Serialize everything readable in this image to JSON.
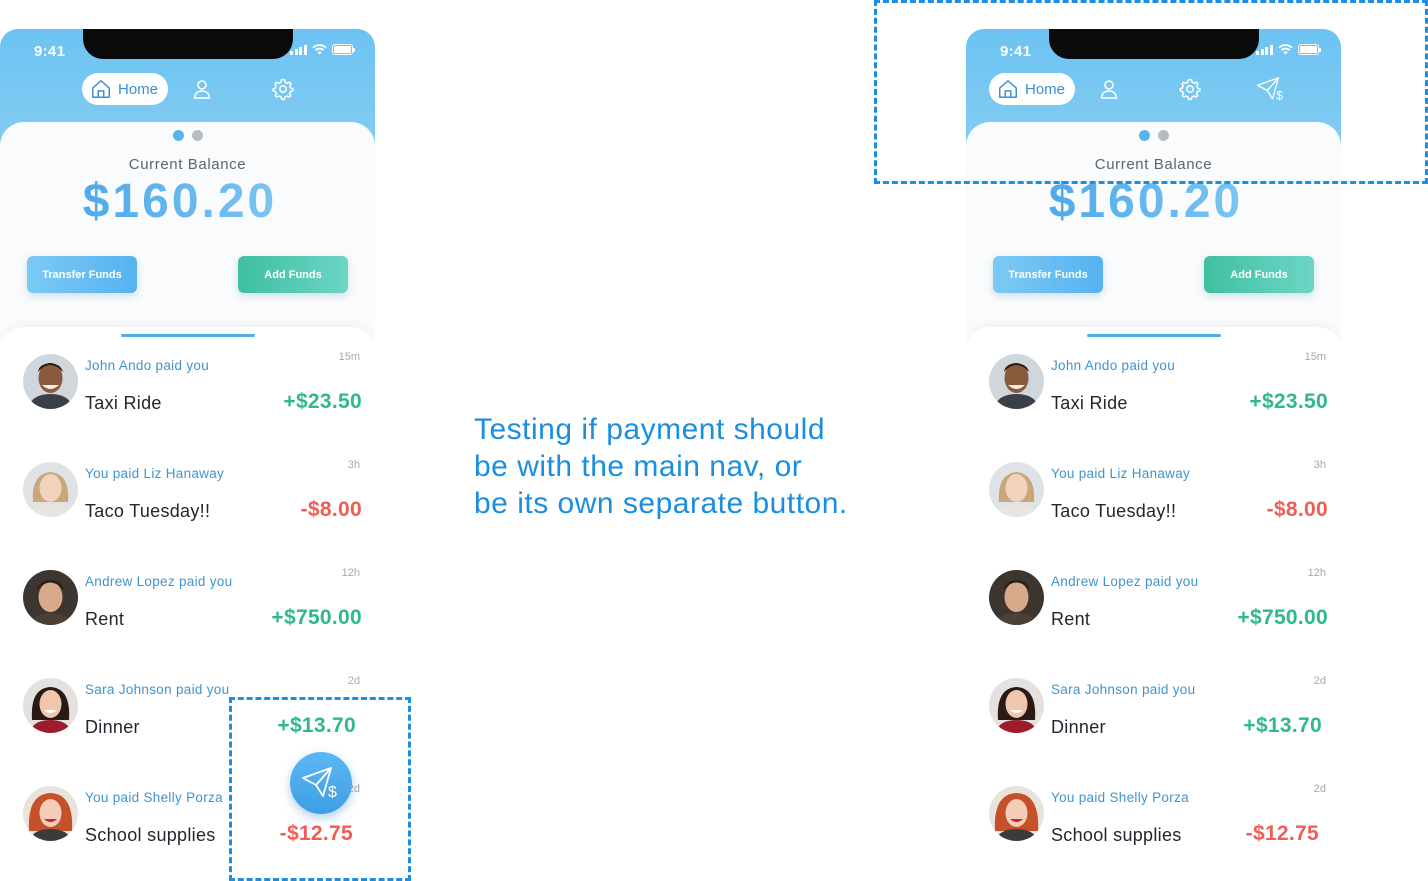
{
  "colors": {
    "accent": "#1a8ee0",
    "header_blue": "#6cc3f2",
    "positive": "#2fb98a",
    "negative": "#ef5d55",
    "dot_active": "#58b4ee",
    "dot_inactive": "#b7bcc3"
  },
  "status_bar": {
    "time": "9:41"
  },
  "nav": {
    "home_label": "Home"
  },
  "balance": {
    "label": "Current Balance",
    "value": "$160.20"
  },
  "actions": {
    "transfer_label": "Transfer Funds",
    "add_label": "Add Funds"
  },
  "transactions": [
    {
      "who": "John Ando paid you",
      "ago": "15m",
      "desc": "Taxi Ride",
      "amount": "+$23.50",
      "sign": "pos"
    },
    {
      "who": "You paid Liz Hanaway",
      "ago": "3h",
      "desc": "Taco Tuesday!!",
      "amount": "-$8.00",
      "sign": "neg"
    },
    {
      "who": "Andrew Lopez paid you",
      "ago": "12h",
      "desc": "Rent",
      "amount": "+$750.00",
      "sign": "pos"
    },
    {
      "who": "Sara Johnson paid you",
      "ago": "2d",
      "desc": "Dinner",
      "amount": "+$13.70",
      "sign": "pos"
    },
    {
      "who": "You paid Shelly Porza",
      "ago": "2d",
      "desc": "School supplies",
      "amount": "-$12.75",
      "sign": "neg"
    }
  ],
  "note": {
    "line1": "Testing if payment should",
    "line2": "be with the main nav, or",
    "line3": "be its own separate button."
  },
  "icons": {
    "home": "home-icon",
    "profile": "person-icon",
    "settings": "gear-icon",
    "send_money": "send-money-icon"
  }
}
